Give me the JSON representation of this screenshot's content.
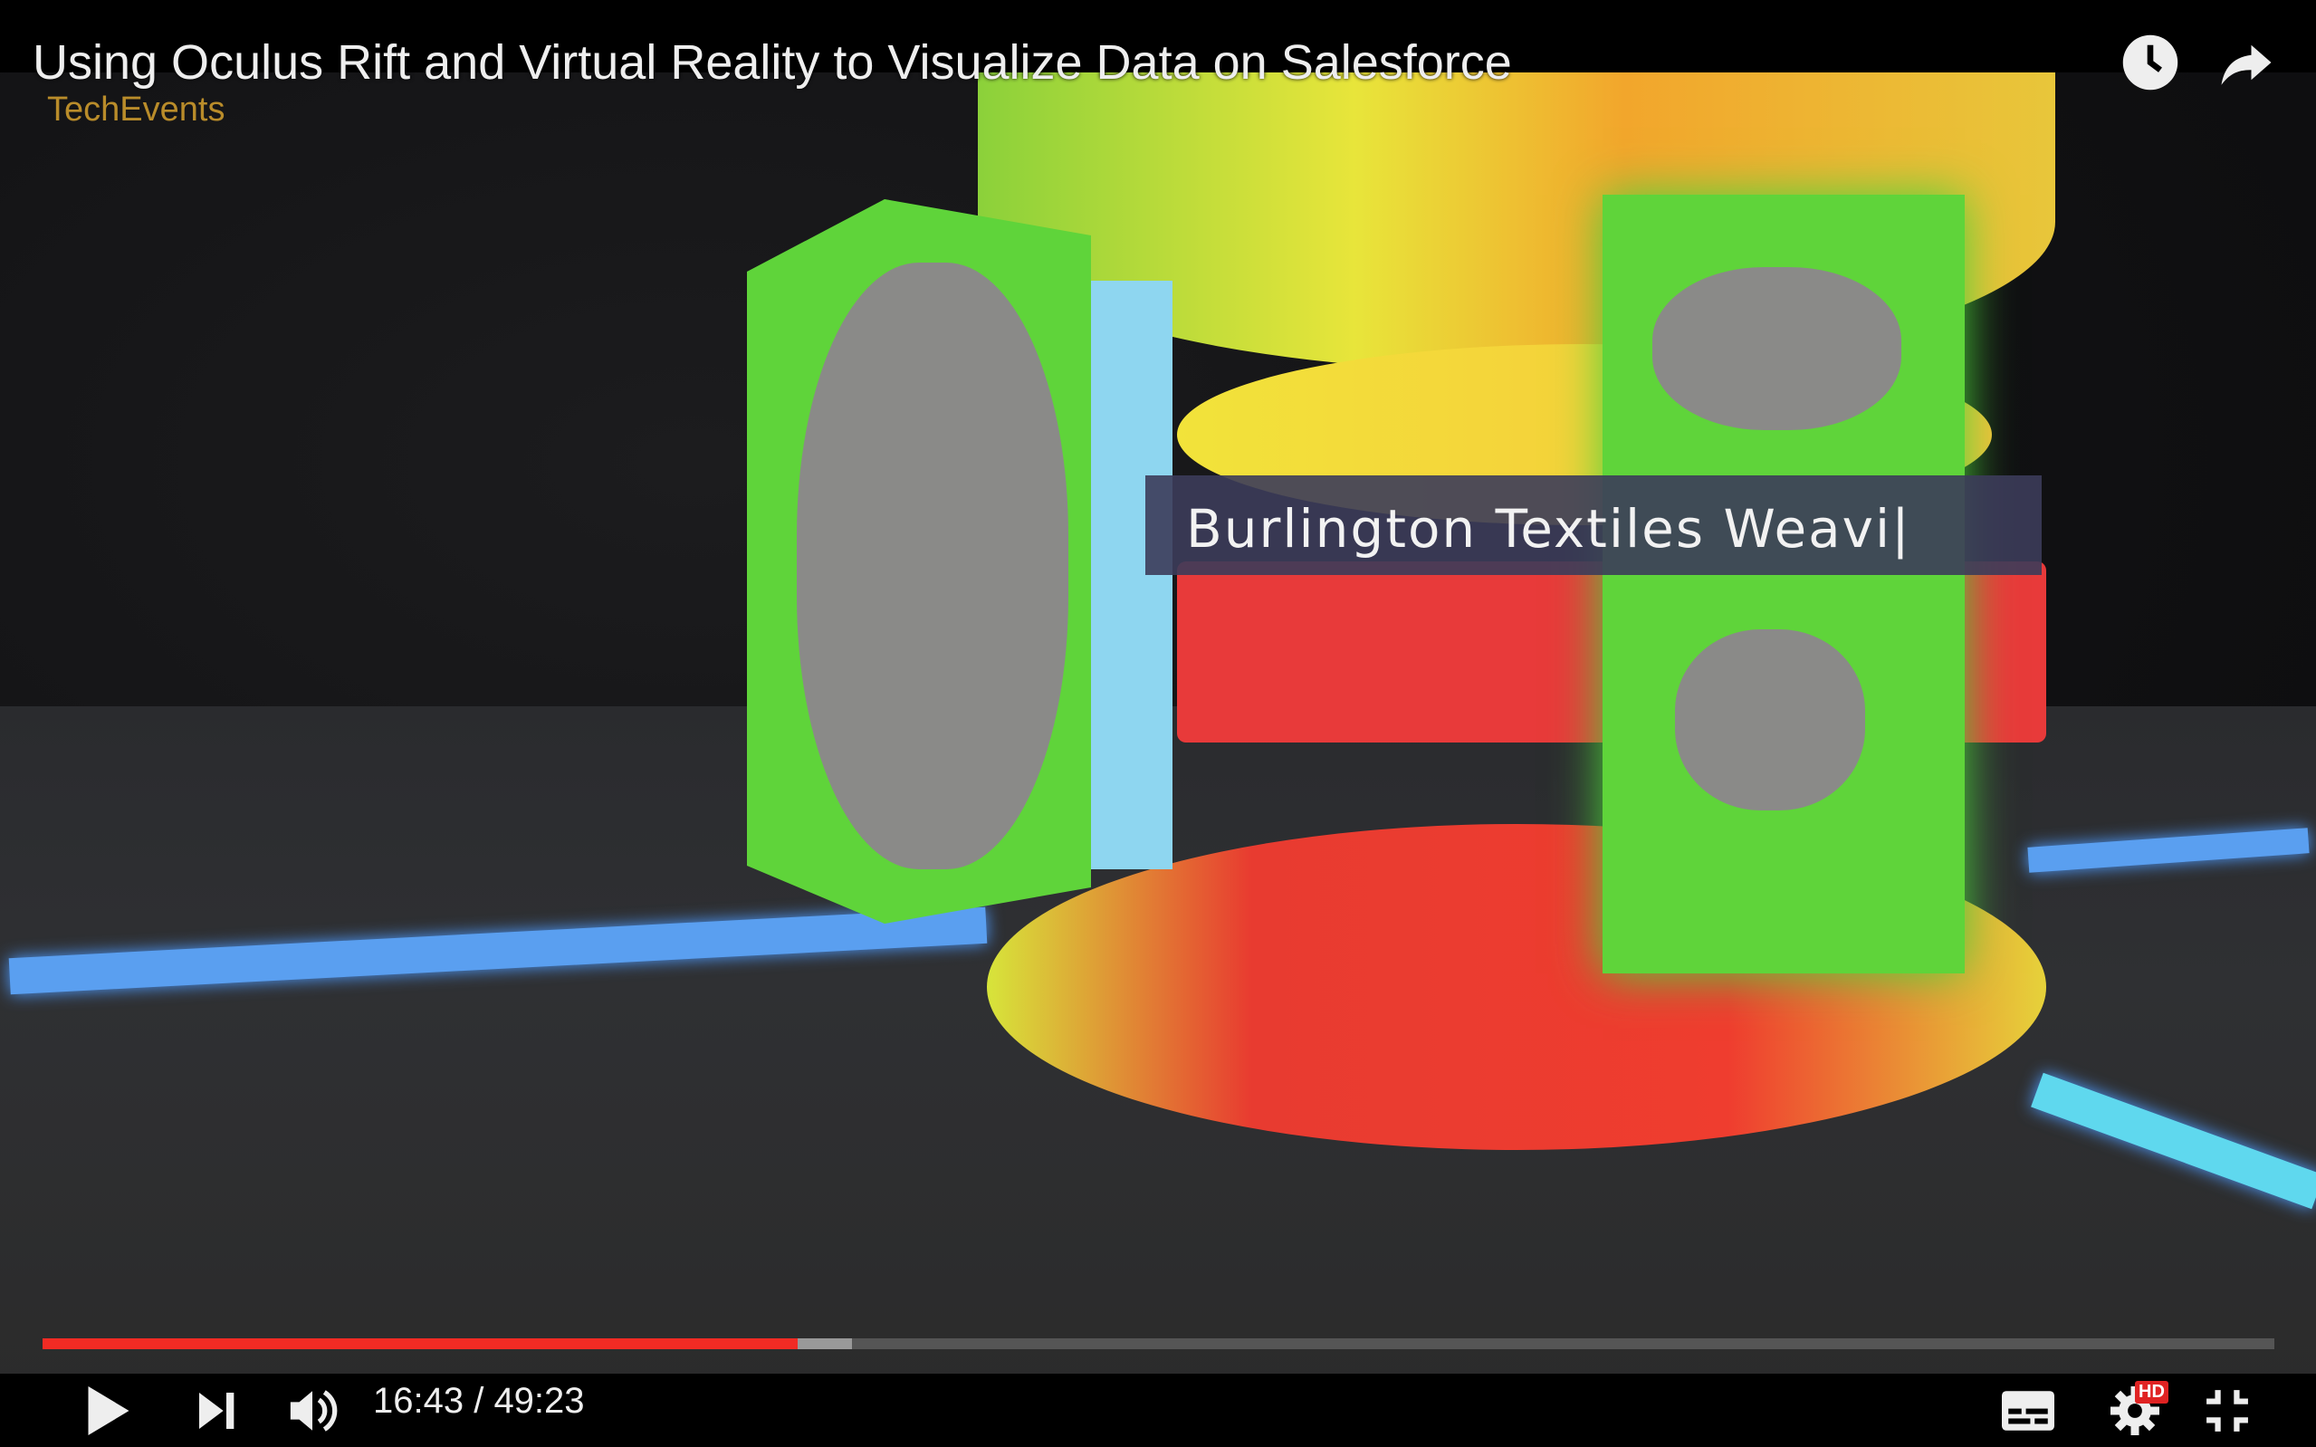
{
  "header": {
    "title": "Using Oculus Rift and Virtual Reality to Visualize Data on Salesforce",
    "channel": "TechEvents",
    "watch_later_icon": "clock-icon",
    "share_icon": "share-arrow-icon"
  },
  "video": {
    "overlay_label": "Burlington Textiles Weavi|"
  },
  "player": {
    "current_time": "16:43",
    "separator": "/",
    "duration": "49:23",
    "time_display": "16:43 / 49:23",
    "progress_fraction": 0.3385,
    "buffered_fraction": 0.3625,
    "hd_badge": "HD",
    "accent_color": "#f12b24"
  }
}
